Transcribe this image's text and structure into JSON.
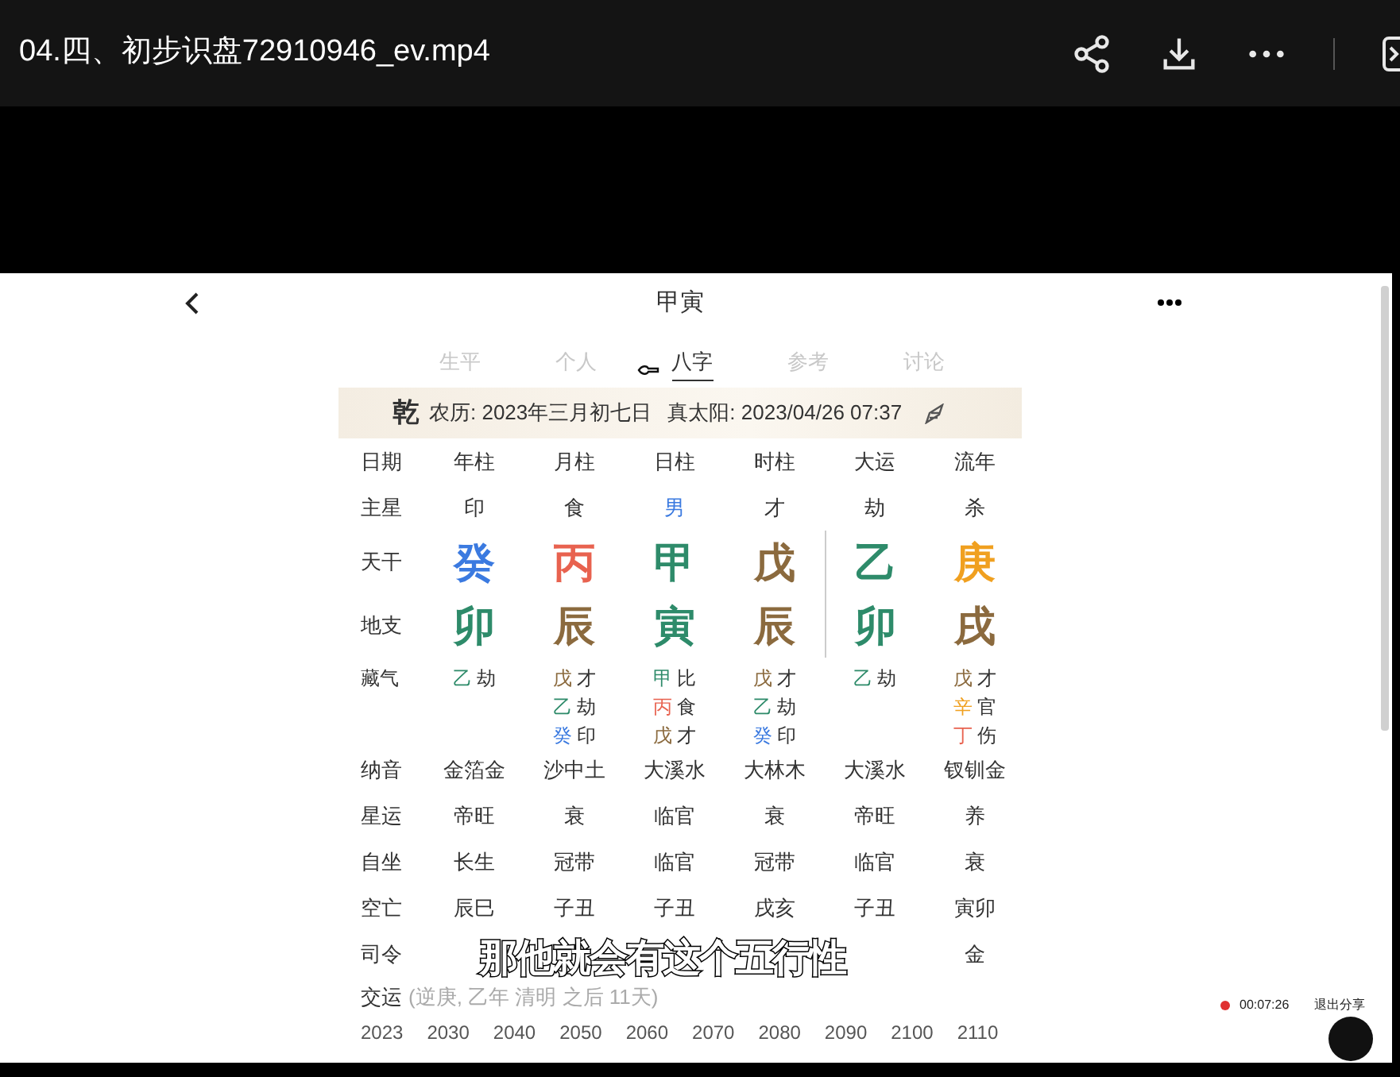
{
  "window": {
    "title": "04.四、初步识盘72910946_ev.mp4"
  },
  "app": {
    "title": "甲寅",
    "tabs": [
      {
        "label": "生平",
        "selected": false
      },
      {
        "label": "个人",
        "selected": false
      },
      {
        "label": "八字",
        "selected": true
      },
      {
        "label": "参考",
        "selected": false
      },
      {
        "label": "讨论",
        "selected": false
      }
    ],
    "info": {
      "gender": "乾",
      "lunar": "农历: 2023年三月初七日",
      "solar": "真太阳: 2023/04/26 07:37"
    },
    "columns": [
      "日期",
      "年柱",
      "月柱",
      "日柱",
      "时柱",
      "大运",
      "流年"
    ],
    "main_star": {
      "label": "主星",
      "cells": [
        {
          "text": "印",
          "color": "#333333"
        },
        {
          "text": "食",
          "color": "#333333"
        },
        {
          "text": "男",
          "color": "#3b7ae0"
        },
        {
          "text": "才",
          "color": "#333333"
        },
        {
          "text": "劫",
          "color": "#333333"
        },
        {
          "text": "杀",
          "color": "#333333"
        }
      ]
    },
    "stems": {
      "label": "天干",
      "cells": [
        {
          "text": "癸",
          "color": "#3b7ae0"
        },
        {
          "text": "丙",
          "color": "#e8624f"
        },
        {
          "text": "甲",
          "color": "#2e8b6a"
        },
        {
          "text": "戊",
          "color": "#8b6a3e"
        },
        {
          "text": "乙",
          "color": "#2e8b6a"
        },
        {
          "text": "庚",
          "color": "#f0a020"
        }
      ]
    },
    "branches": {
      "label": "地支",
      "cells": [
        {
          "text": "卯",
          "color": "#2e8b6a"
        },
        {
          "text": "辰",
          "color": "#8b6a3e"
        },
        {
          "text": "寅",
          "color": "#2e8b6a"
        },
        {
          "text": "辰",
          "color": "#8b6a3e"
        },
        {
          "text": "卯",
          "color": "#2e8b6a"
        },
        {
          "text": "戌",
          "color": "#8b6a3e"
        }
      ]
    },
    "hidden": {
      "label": "藏气",
      "columns": [
        [
          {
            "stem": "乙",
            "god": "劫",
            "color": "#2e8b6a"
          }
        ],
        [
          {
            "stem": "戊",
            "god": "才",
            "color": "#8b6a3e"
          },
          {
            "stem": "乙",
            "god": "劫",
            "color": "#2e8b6a"
          },
          {
            "stem": "癸",
            "god": "印",
            "color": "#3b7ae0"
          }
        ],
        [
          {
            "stem": "甲",
            "god": "比",
            "color": "#2e8b6a"
          },
          {
            "stem": "丙",
            "god": "食",
            "color": "#e8624f"
          },
          {
            "stem": "戊",
            "god": "才",
            "color": "#8b6a3e"
          }
        ],
        [
          {
            "stem": "戊",
            "god": "才",
            "color": "#8b6a3e"
          },
          {
            "stem": "乙",
            "god": "劫",
            "color": "#2e8b6a"
          },
          {
            "stem": "癸",
            "god": "印",
            "color": "#3b7ae0"
          }
        ],
        [
          {
            "stem": "乙",
            "god": "劫",
            "color": "#2e8b6a"
          }
        ],
        [
          {
            "stem": "戊",
            "god": "才",
            "color": "#8b6a3e"
          },
          {
            "stem": "辛",
            "god": "官",
            "color": "#f0a020"
          },
          {
            "stem": "丁",
            "god": "伤",
            "color": "#e8624f"
          }
        ]
      ]
    },
    "text_rows": [
      {
        "label": "纳音",
        "cells": [
          "金箔金",
          "沙中土",
          "大溪水",
          "大林木",
          "大溪水",
          "钗钏金"
        ]
      },
      {
        "label": "星运",
        "cells": [
          "帝旺",
          "衰",
          "临官",
          "衰",
          "帝旺",
          "养"
        ]
      },
      {
        "label": "自坐",
        "cells": [
          "长生",
          "冠带",
          "临官",
          "冠带",
          "临官",
          "衰"
        ]
      },
      {
        "label": "空亡",
        "cells": [
          "辰巳",
          "子丑",
          "子丑",
          "戌亥",
          "子丑",
          "寅卯"
        ]
      }
    ],
    "partial_row": {
      "label": "司令",
      "last": "金"
    },
    "luck": {
      "label": "交运",
      "detail": "(逆庚, 乙年 清明 之后 11天)",
      "years": [
        "2023",
        "2030",
        "2040",
        "2050",
        "2060",
        "2070",
        "2080",
        "2090",
        "2100",
        "2110"
      ]
    }
  },
  "subtitle": "那他就会有这个五行性",
  "recording": {
    "time": "00:07:26",
    "exit": "退出分享"
  }
}
